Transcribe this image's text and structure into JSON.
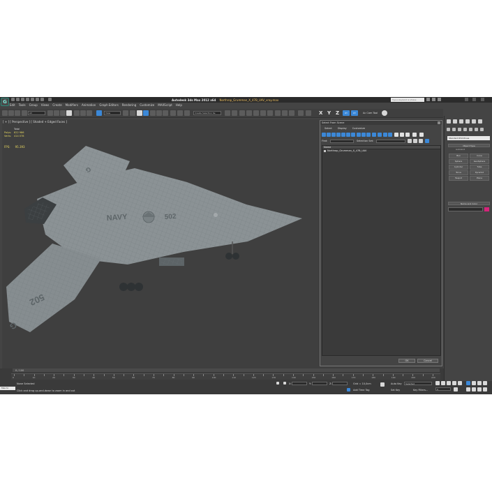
{
  "app": {
    "logo": "G",
    "title_prefix": "Autodesk 3ds Max  2012 x64",
    "file_name": "Northrop_Grumman_X_47B_UAV_vray.max",
    "search_placeholder": "Type a keyword or phrase"
  },
  "menu": [
    "Edit",
    "Tools",
    "Group",
    "Views",
    "Create",
    "Modifiers",
    "Animation",
    "Graph Editors",
    "Rendering",
    "Customize",
    "MAXScript",
    "Help"
  ],
  "toolbar": {
    "filter_value": "All",
    "view_value": "View",
    "selection_set_value": "Create Selection Se",
    "axis_x": "X",
    "axis_y": "Y",
    "axis_z": "Z",
    "plane_xy": "XY",
    "plane_xy2": "XY",
    "cam_tool": "Ac Cam Tool",
    "cam_icon": "camera-icon"
  },
  "viewport": {
    "label": "[ + ] [ Perspective ] [ Shaded + Edged Faces ]",
    "stats_header": "Total",
    "stats": [
      {
        "label": "Polys:",
        "value": "822 986"
      },
      {
        "label": "Verts:",
        "value": "414 078"
      }
    ],
    "fps_label": "FPS:",
    "fps_value": "95.393",
    "aircraft_text_navy": "NAVY",
    "aircraft_text_502": "502",
    "aircraft_text_502_wing": "502",
    "aircraft_text_g": "G"
  },
  "dialog": {
    "title": "Select From Scene",
    "menu": [
      "Select",
      "Display",
      "Customize"
    ],
    "find_label": "Find:",
    "selection_set_label": "Selection Set:",
    "column_header": "Name",
    "items": [
      "Northrop_Grumman_X_47B_UAV"
    ],
    "ok_label": "OK",
    "cancel_label": "Cancel"
  },
  "command_panel": {
    "category": "Standard Primitives",
    "object_type_header": "Object Type",
    "autogrid": "AutoGrid",
    "objects": [
      "Box",
      "Cone",
      "Sphere",
      "GeoSphere",
      "Cylinder",
      "Tube",
      "Torus",
      "Pyramid",
      "Teapot",
      "Plane"
    ],
    "name_color_header": "Name and Color"
  },
  "timeline": {
    "frame_counter": "0 / 100",
    "ticks": [
      "0",
      "5",
      "10",
      "15",
      "20",
      "25",
      "30",
      "35",
      "40",
      "45",
      "50",
      "55",
      "60",
      "65",
      "70",
      "75",
      "80",
      "85",
      "90",
      "95",
      "100",
      "105",
      "110",
      "115",
      "120",
      "125",
      "130",
      "135",
      "140",
      "145",
      "150",
      "155",
      "160",
      "165",
      "170",
      "175",
      "180",
      "185",
      "190",
      "195",
      "200",
      "210",
      "220"
    ]
  },
  "status": {
    "maxscript": "Max to",
    "selection": "None Selected",
    "prompt": "Click and drag up-and-down to zoom in and out",
    "x_label": "X:",
    "y_label": "Y:",
    "z_label": "Z:",
    "grid": "Grid = 10,0cm",
    "add_time_tag": "Add Time Tag",
    "auto_key": "Auto Key",
    "selected": "Selected",
    "set_key": "Set Key",
    "key_filters": "Key Filters...",
    "frame": "0"
  }
}
